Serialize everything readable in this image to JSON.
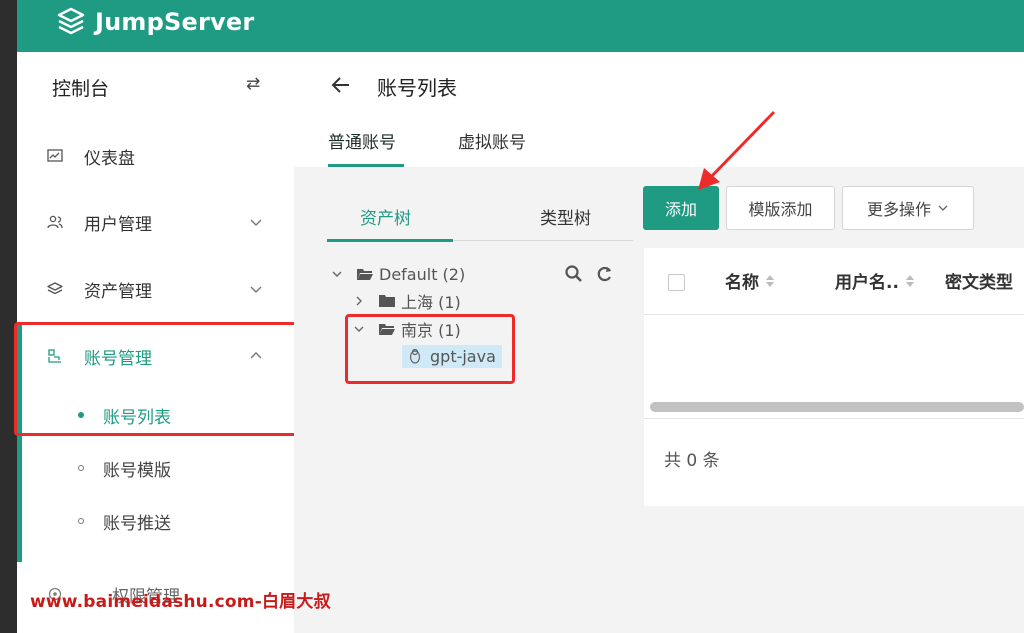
{
  "brand": {
    "name": "JumpServer",
    "header_color": "#1f9a83"
  },
  "sidebar": {
    "title": "控制台",
    "swap_icon": "⇄",
    "items": [
      {
        "label": "仪表盘",
        "icon": "dashboard-icon"
      },
      {
        "label": "用户管理",
        "icon": "users-icon"
      },
      {
        "label": "资产管理",
        "icon": "assets-icon"
      },
      {
        "label": "账号管理",
        "icon": "accounts-icon"
      },
      {
        "label": "权限管理",
        "icon": "permission-icon"
      }
    ],
    "sub_items": [
      {
        "label": "账号列表"
      },
      {
        "label": "账号模版"
      },
      {
        "label": "账号推送"
      }
    ]
  },
  "main": {
    "title": "账号列表",
    "tabs": [
      {
        "label": "普通账号"
      },
      {
        "label": "虚拟账号"
      }
    ]
  },
  "tree": {
    "tabs": [
      {
        "label": "资产树"
      },
      {
        "label": "类型树"
      }
    ],
    "nodes": [
      {
        "label": "Default (2)"
      },
      {
        "label": "上海 (1)"
      },
      {
        "label": "南京 (1)"
      },
      {
        "label": "gpt-java"
      }
    ]
  },
  "toolbar": {
    "add_label": "添加",
    "template_add_label": "模版添加",
    "more_label": "更多操作"
  },
  "table": {
    "columns": [
      "名称",
      "用户名..",
      "密文类型"
    ],
    "total_text": "共 0 条"
  },
  "watermark": "www.baimeidashu.com-白眉大叔"
}
